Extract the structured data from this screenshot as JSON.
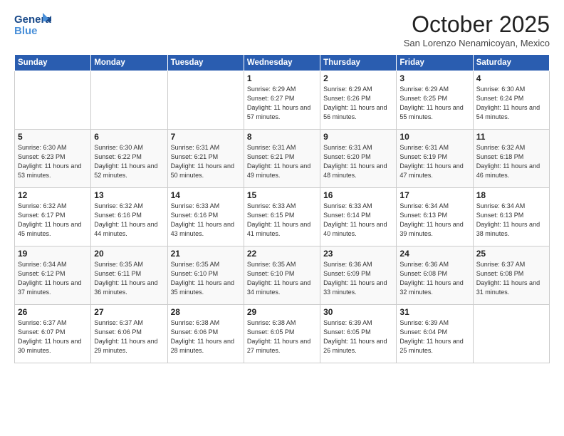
{
  "logo": {
    "line1": "General",
    "line2": "Blue"
  },
  "title": "October 2025",
  "subtitle": "San Lorenzo Nenamicoyan, Mexico",
  "weekdays": [
    "Sunday",
    "Monday",
    "Tuesday",
    "Wednesday",
    "Thursday",
    "Friday",
    "Saturday"
  ],
  "weeks": [
    [
      {
        "day": "",
        "info": ""
      },
      {
        "day": "",
        "info": ""
      },
      {
        "day": "",
        "info": ""
      },
      {
        "day": "1",
        "info": "Sunrise: 6:29 AM\nSunset: 6:27 PM\nDaylight: 11 hours and 57 minutes."
      },
      {
        "day": "2",
        "info": "Sunrise: 6:29 AM\nSunset: 6:26 PM\nDaylight: 11 hours and 56 minutes."
      },
      {
        "day": "3",
        "info": "Sunrise: 6:29 AM\nSunset: 6:25 PM\nDaylight: 11 hours and 55 minutes."
      },
      {
        "day": "4",
        "info": "Sunrise: 6:30 AM\nSunset: 6:24 PM\nDaylight: 11 hours and 54 minutes."
      }
    ],
    [
      {
        "day": "5",
        "info": "Sunrise: 6:30 AM\nSunset: 6:23 PM\nDaylight: 11 hours and 53 minutes."
      },
      {
        "day": "6",
        "info": "Sunrise: 6:30 AM\nSunset: 6:22 PM\nDaylight: 11 hours and 52 minutes."
      },
      {
        "day": "7",
        "info": "Sunrise: 6:31 AM\nSunset: 6:21 PM\nDaylight: 11 hours and 50 minutes."
      },
      {
        "day": "8",
        "info": "Sunrise: 6:31 AM\nSunset: 6:21 PM\nDaylight: 11 hours and 49 minutes."
      },
      {
        "day": "9",
        "info": "Sunrise: 6:31 AM\nSunset: 6:20 PM\nDaylight: 11 hours and 48 minutes."
      },
      {
        "day": "10",
        "info": "Sunrise: 6:31 AM\nSunset: 6:19 PM\nDaylight: 11 hours and 47 minutes."
      },
      {
        "day": "11",
        "info": "Sunrise: 6:32 AM\nSunset: 6:18 PM\nDaylight: 11 hours and 46 minutes."
      }
    ],
    [
      {
        "day": "12",
        "info": "Sunrise: 6:32 AM\nSunset: 6:17 PM\nDaylight: 11 hours and 45 minutes."
      },
      {
        "day": "13",
        "info": "Sunrise: 6:32 AM\nSunset: 6:16 PM\nDaylight: 11 hours and 44 minutes."
      },
      {
        "day": "14",
        "info": "Sunrise: 6:33 AM\nSunset: 6:16 PM\nDaylight: 11 hours and 43 minutes."
      },
      {
        "day": "15",
        "info": "Sunrise: 6:33 AM\nSunset: 6:15 PM\nDaylight: 11 hours and 41 minutes."
      },
      {
        "day": "16",
        "info": "Sunrise: 6:33 AM\nSunset: 6:14 PM\nDaylight: 11 hours and 40 minutes."
      },
      {
        "day": "17",
        "info": "Sunrise: 6:34 AM\nSunset: 6:13 PM\nDaylight: 11 hours and 39 minutes."
      },
      {
        "day": "18",
        "info": "Sunrise: 6:34 AM\nSunset: 6:13 PM\nDaylight: 11 hours and 38 minutes."
      }
    ],
    [
      {
        "day": "19",
        "info": "Sunrise: 6:34 AM\nSunset: 6:12 PM\nDaylight: 11 hours and 37 minutes."
      },
      {
        "day": "20",
        "info": "Sunrise: 6:35 AM\nSunset: 6:11 PM\nDaylight: 11 hours and 36 minutes."
      },
      {
        "day": "21",
        "info": "Sunrise: 6:35 AM\nSunset: 6:10 PM\nDaylight: 11 hours and 35 minutes."
      },
      {
        "day": "22",
        "info": "Sunrise: 6:35 AM\nSunset: 6:10 PM\nDaylight: 11 hours and 34 minutes."
      },
      {
        "day": "23",
        "info": "Sunrise: 6:36 AM\nSunset: 6:09 PM\nDaylight: 11 hours and 33 minutes."
      },
      {
        "day": "24",
        "info": "Sunrise: 6:36 AM\nSunset: 6:08 PM\nDaylight: 11 hours and 32 minutes."
      },
      {
        "day": "25",
        "info": "Sunrise: 6:37 AM\nSunset: 6:08 PM\nDaylight: 11 hours and 31 minutes."
      }
    ],
    [
      {
        "day": "26",
        "info": "Sunrise: 6:37 AM\nSunset: 6:07 PM\nDaylight: 11 hours and 30 minutes."
      },
      {
        "day": "27",
        "info": "Sunrise: 6:37 AM\nSunset: 6:06 PM\nDaylight: 11 hours and 29 minutes."
      },
      {
        "day": "28",
        "info": "Sunrise: 6:38 AM\nSunset: 6:06 PM\nDaylight: 11 hours and 28 minutes."
      },
      {
        "day": "29",
        "info": "Sunrise: 6:38 AM\nSunset: 6:05 PM\nDaylight: 11 hours and 27 minutes."
      },
      {
        "day": "30",
        "info": "Sunrise: 6:39 AM\nSunset: 6:05 PM\nDaylight: 11 hours and 26 minutes."
      },
      {
        "day": "31",
        "info": "Sunrise: 6:39 AM\nSunset: 6:04 PM\nDaylight: 11 hours and 25 minutes."
      },
      {
        "day": "",
        "info": ""
      }
    ]
  ]
}
